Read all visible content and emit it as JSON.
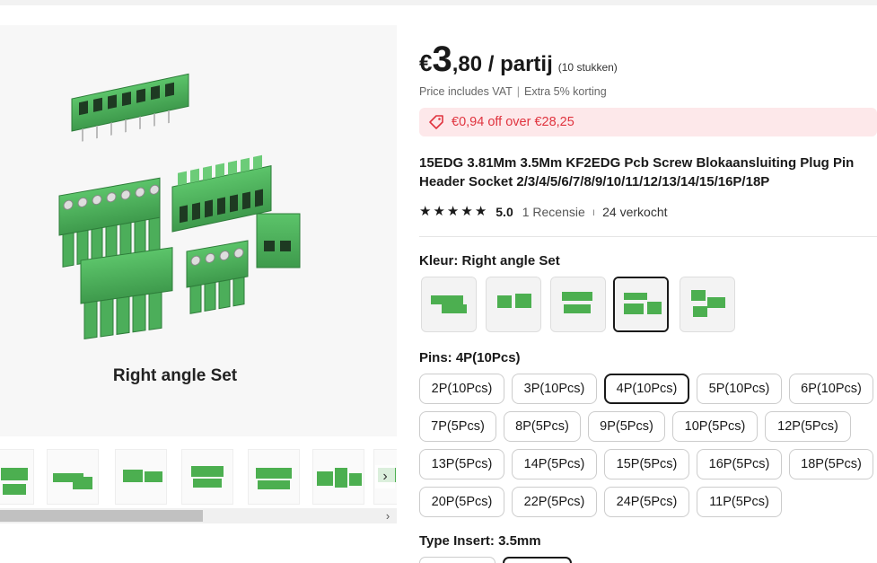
{
  "gallery": {
    "main_caption": "Right angle Set",
    "thumbnails": [
      {
        "label": "",
        "icon": "terminal-set-thumb"
      },
      {
        "label": "Right angle socket",
        "icon": "terminal-socket-thumb"
      },
      {
        "label": "Plug",
        "icon": "terminal-plug-thumb"
      },
      {
        "label": "Straight socket",
        "icon": "terminal-straight-thumb"
      },
      {
        "label": "Right Angle socket",
        "icon": "terminal-rightangle-thumb"
      },
      {
        "label": "",
        "icon": "terminal-mixed-thumb"
      },
      {
        "label": "",
        "icon": "terminal-partial-thumb"
      }
    ],
    "next_icon": "›",
    "scroll_right_icon": "›"
  },
  "price": {
    "currency": "€",
    "integer": "3",
    "rest": ",80 / partij",
    "quantity": "(10 stukken)"
  },
  "vat": {
    "text": "Price includes VAT",
    "separator": "|",
    "extra": "Extra 5% korting"
  },
  "coupon": {
    "text": "€0,94 off over €28,25",
    "color": "#e0343f"
  },
  "title": "15EDG 3.81Mm 3.5Mm KF2EDG Pcb Screw Blokaansluiting Plug Pin Header Socket 2/3/4/5/6/7/8/9/10/11/12/13/14/15/16P/18P",
  "rating": {
    "stars": 5,
    "score": "5.0",
    "reviews": "1 Recensie",
    "separator": "ı",
    "sold": "24 verkocht"
  },
  "color": {
    "label": "Kleur: ",
    "value": "Right angle Set",
    "swatches": [
      {
        "label": "Right Angle socket",
        "selected": false
      },
      {
        "label": "Plug",
        "selected": false
      },
      {
        "label": "Straight socket",
        "selected": false
      },
      {
        "label": "Right angle Set",
        "selected": true
      },
      {
        "label": "Straight Set",
        "selected": false
      }
    ]
  },
  "pins": {
    "label": "Pins: 4P(10Pcs)",
    "options": [
      [
        "2P(10Pcs)",
        "3P(10Pcs)",
        "4P(10Pcs)",
        "5P(10Pcs)",
        "6P(10Pcs)"
      ],
      [
        "7P(5Pcs)",
        "8P(5Pcs)",
        "9P(5Pcs)",
        "10P(5Pcs)",
        "12P(5Pcs)"
      ],
      [
        "13P(5Pcs)",
        "14P(5Pcs)",
        "15P(5Pcs)",
        "16P(5Pcs)",
        "18P(5Pcs)"
      ],
      [
        "20P(5Pcs)",
        "22P(5Pcs)",
        "24P(5Pcs)",
        "11P(5Pcs)"
      ]
    ],
    "selected": "4P(10Pcs)"
  },
  "type_insert": {
    "label": "Type Insert: 3.5mm"
  },
  "colors": {
    "accent": "#191919",
    "connector_green": "#4caf50"
  }
}
